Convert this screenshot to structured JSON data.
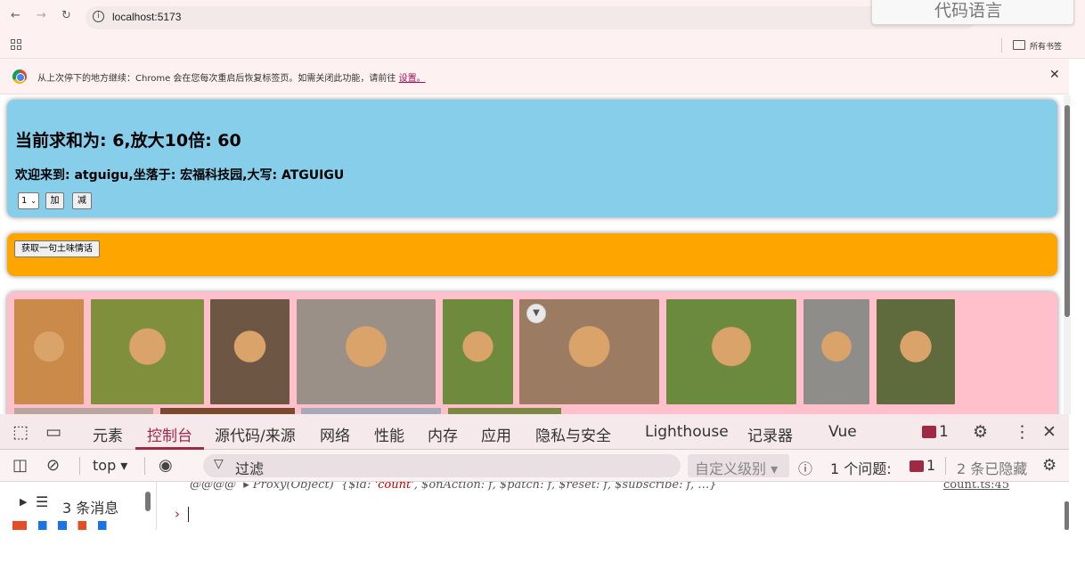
{
  "browser": {
    "url": "localhost:5173",
    "floating_text": "代码语言",
    "bookmarks_label": "所有书签",
    "infobar_text": "从上次停下的地方继续：Chrome 会在您每次重启后恢复标签页。如需关闭此功能，请前往",
    "infobar_link": "设置。"
  },
  "count": {
    "sum_text": "当前求和为: 6,放大10倍: 60",
    "welcome_text": "欢迎来到: atguigu,坐落于: 宏福科技园,大写: ATGUIGU",
    "select_value": "1",
    "add_label": "加",
    "sub_label": "减"
  },
  "love_talk": {
    "button_label": "获取一句土味情话"
  },
  "dogs": {
    "colors": [
      "#c98a4a",
      "#7f8f3c",
      "#6d5644",
      "#9a9087",
      "#6e8a3d",
      "#9b7c62",
      "#6c8a3e",
      "#8f8d89",
      "#5f6b3c"
    ],
    "row2_colors": [
      "#b9a49e",
      "#7a4a2c",
      "#a6a9b8",
      "#7d8a44"
    ]
  },
  "devtools": {
    "tabs": [
      "元素",
      "控制台",
      "源代码/来源",
      "网络",
      "性能",
      "内存",
      "应用",
      "隐私与安全",
      "Lighthouse",
      "记录器",
      "Vue"
    ],
    "active_tab": "控制台",
    "message_count": "1",
    "context": "top",
    "filter_placeholder": "过滤",
    "level_label": "自定义级别",
    "issues_label": "1 个问题:",
    "issues_count": "1",
    "hidden_label": "2 条已隐藏",
    "sidebar_messages": "3 条消息",
    "log_prefix": "@@@@",
    "log_proxy": "▸ Proxy(Object)",
    "log_body_1": "{$id: ",
    "log_id": "'count'",
    "log_body_2": ", $onAction: f, $patch: f, $reset: f, $subscribe: f,  …}",
    "log_source": "count.ts:45",
    "prompt_symbol": "›"
  }
}
